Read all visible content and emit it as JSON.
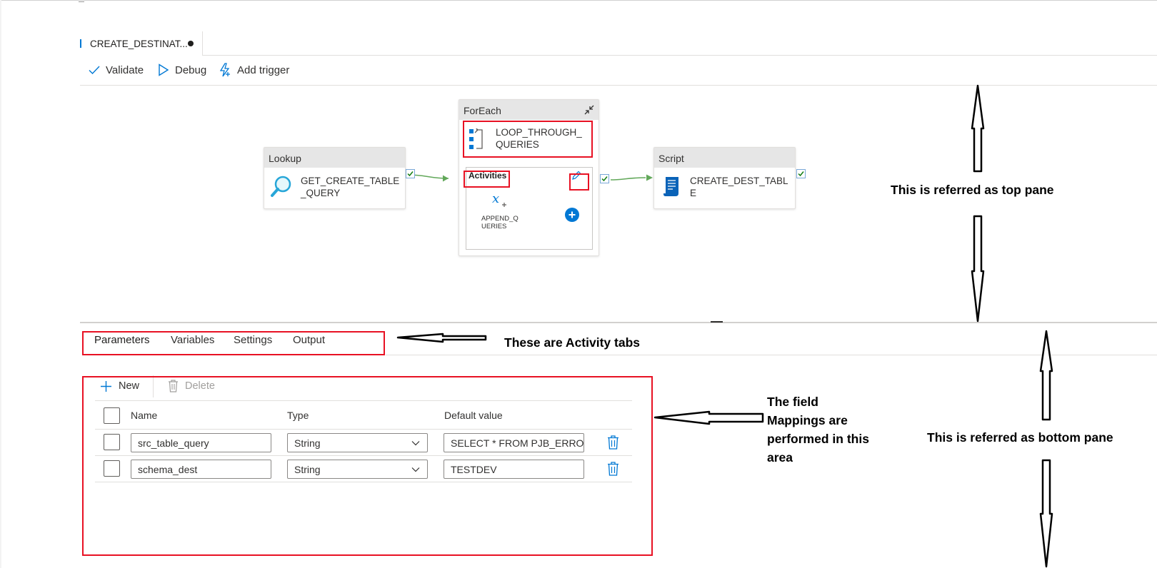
{
  "tab": {
    "title": "CREATE_DESTINAT...",
    "unsaved": true
  },
  "toolbar": {
    "validate": "Validate",
    "debug": "Debug",
    "add_trigger": "Add trigger"
  },
  "canvas": {
    "lookup": {
      "type": "Lookup",
      "name": "GET_CREATE_TABLE\n_QUERY"
    },
    "foreach": {
      "type": "ForEach",
      "name": "LOOP_THROUGH_\nQUERIES",
      "activities_label": "Activities",
      "inner_name": "APPEND_Q\nUERIES"
    },
    "script": {
      "type": "Script",
      "name": "CREATE_DEST_TABL\nE"
    }
  },
  "activity_tabs": [
    "Parameters",
    "Variables",
    "Settings",
    "Output"
  ],
  "params": {
    "new_label": "New",
    "delete_label": "Delete",
    "headers": {
      "name": "Name",
      "type": "Type",
      "default": "Default value"
    },
    "rows": [
      {
        "name": "src_table_query",
        "type": "String",
        "default": "SELECT * FROM PJB_ERROR"
      },
      {
        "name": "schema_dest",
        "type": "String",
        "default": "TESTDEV"
      }
    ]
  },
  "annotations": {
    "top_pane": "This is referred as top pane",
    "activity_tabs": "These are Activity tabs",
    "field_mappings": "The field\nMappings are\nperformed in this\narea",
    "bottom_pane": "This is referred as bottom pane"
  },
  "colors": {
    "accent": "#0078d4",
    "highlight": "#e81123",
    "success": "#107c10"
  }
}
